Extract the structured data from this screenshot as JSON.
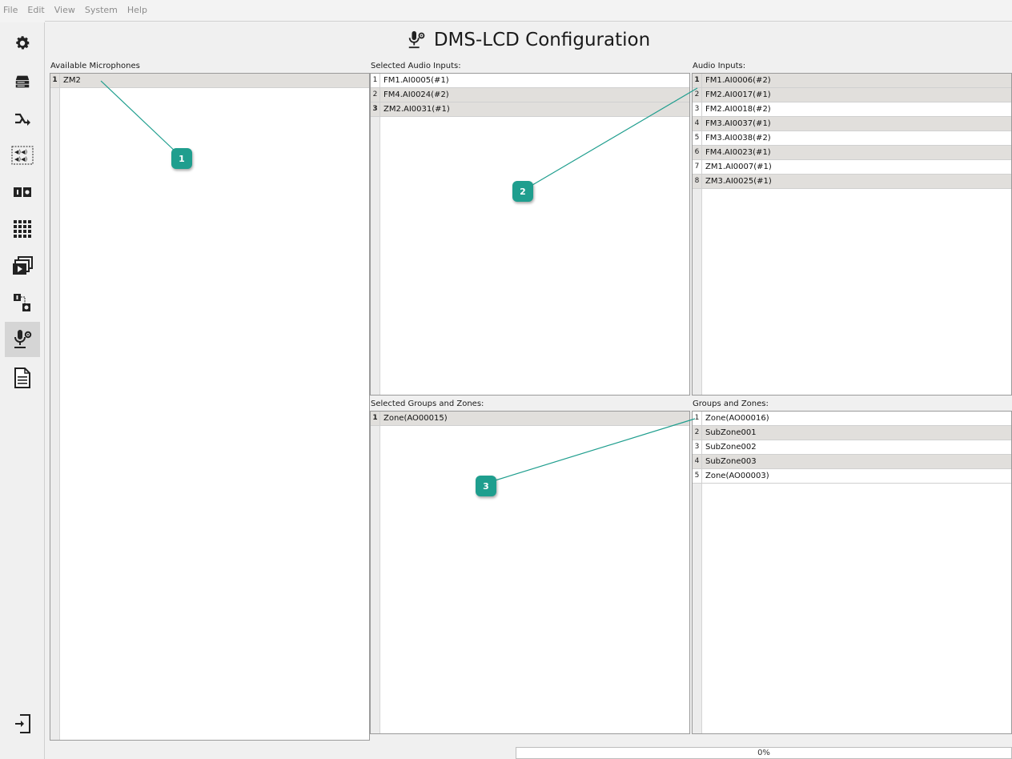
{
  "menu": [
    "File",
    "Edit",
    "View",
    "System",
    "Help"
  ],
  "title": "DMS-LCD Configuration",
  "sidebar": {
    "items": [
      {
        "icon": "gear-icon"
      },
      {
        "icon": "server-icon"
      },
      {
        "icon": "routing-icon"
      },
      {
        "icon": "speakers-grid-icon"
      },
      {
        "icon": "io-icon"
      },
      {
        "icon": "matrix-icon"
      },
      {
        "icon": "playlist-icon"
      },
      {
        "icon": "link-devices-icon"
      },
      {
        "icon": "microphone-config-icon",
        "active": true
      },
      {
        "icon": "document-icon"
      }
    ],
    "bottom": {
      "icon": "logout-icon"
    }
  },
  "available_microphones": {
    "label": "Available Microphones",
    "rows": [
      {
        "num": "1",
        "text": "ZM2",
        "bold": true
      }
    ]
  },
  "selected_audio_inputs": {
    "label": "Selected Audio Inputs:",
    "rows": [
      {
        "num": "1",
        "text": "FM1.AI0005(#1)"
      },
      {
        "num": "2",
        "text": "FM4.AI0024(#2)"
      },
      {
        "num": "3",
        "text": "ZM2.AI0031(#1)",
        "bold": true
      }
    ]
  },
  "audio_inputs": {
    "label": "Audio Inputs:",
    "rows": [
      {
        "num": "1",
        "text": "FM1.AI0006(#2)",
        "bold": true
      },
      {
        "num": "2",
        "text": "FM2.AI0017(#1)"
      },
      {
        "num": "3",
        "text": "FM2.AI0018(#2)"
      },
      {
        "num": "4",
        "text": "FM3.AI0037(#1)"
      },
      {
        "num": "5",
        "text": "FM3.AI0038(#2)"
      },
      {
        "num": "6",
        "text": "FM4.AI0023(#1)"
      },
      {
        "num": "7",
        "text": "ZM1.AI0007(#1)"
      },
      {
        "num": "8",
        "text": "ZM3.AI0025(#1)"
      }
    ]
  },
  "selected_groups_zones": {
    "label": "Selected Groups and Zones:",
    "rows": [
      {
        "num": "1",
        "text": "Zone(AO00015)",
        "bold": true
      }
    ]
  },
  "groups_zones": {
    "label": "Groups and Zones:",
    "rows": [
      {
        "num": "1",
        "text": "Zone(AO00016)"
      },
      {
        "num": "2",
        "text": "SubZone001"
      },
      {
        "num": "3",
        "text": "SubZone002"
      },
      {
        "num": "4",
        "text": "SubZone003"
      },
      {
        "num": "5",
        "text": "Zone(AO00003)"
      }
    ]
  },
  "callouts": [
    "1",
    "2",
    "3"
  ],
  "progress": {
    "text": "0%",
    "value": 0
  },
  "colors": {
    "callout": "#1f9e8e",
    "row_alt": "#e1dfdc",
    "active_sidebar": "#d5d5d5"
  }
}
